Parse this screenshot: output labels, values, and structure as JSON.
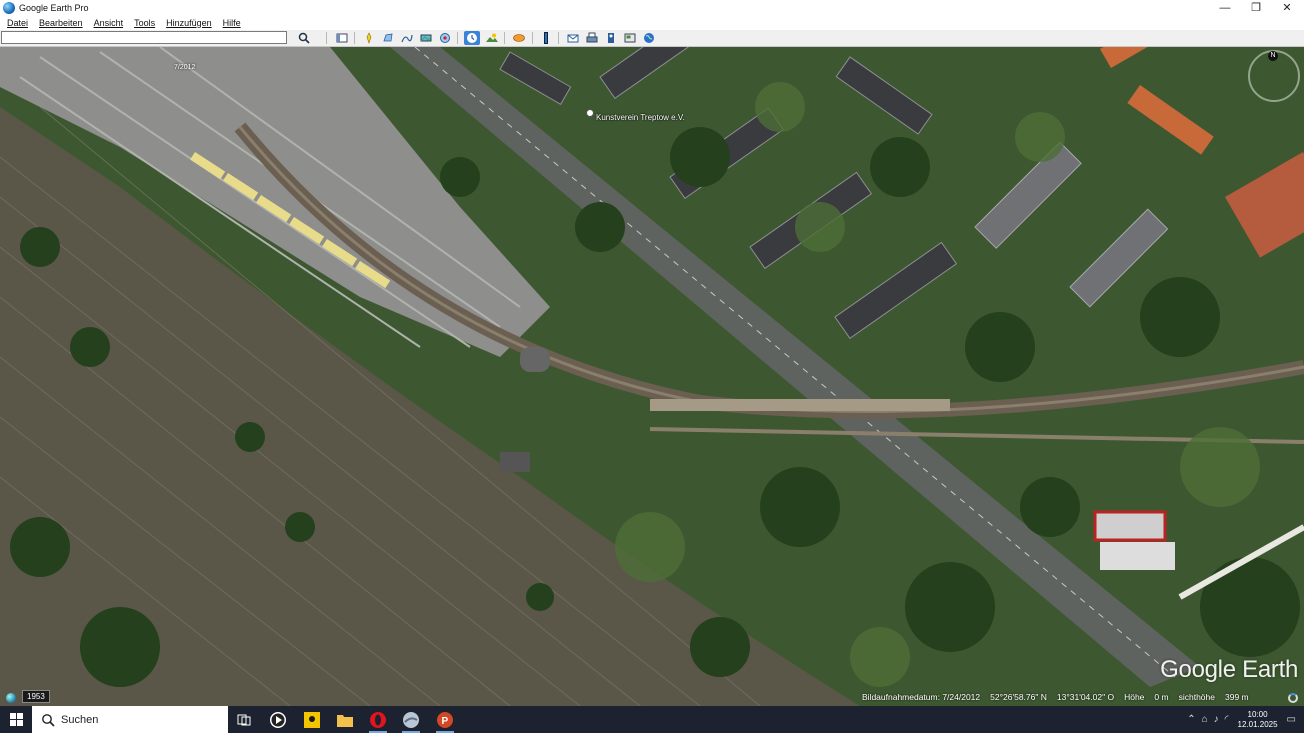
{
  "window": {
    "title": "Google Earth Pro",
    "controls": [
      "minimize-icon",
      "maximize-icon",
      "close-icon"
    ]
  },
  "menu": {
    "items": [
      {
        "label": "Datei"
      },
      {
        "label": "Bearbeiten"
      },
      {
        "label": "Ansicht"
      },
      {
        "label": "Tools"
      },
      {
        "label": "Hinzufügen"
      },
      {
        "label": "Hilfe"
      }
    ]
  },
  "toolbar": {
    "search_value": "",
    "buttons": [
      {
        "icon": "search-icon"
      },
      {
        "icon": "sidebar-toggle-icon"
      },
      {
        "icon": "add-placemark-icon"
      },
      {
        "icon": "add-polygon-icon"
      },
      {
        "icon": "add-path-icon"
      },
      {
        "icon": "add-overlay-icon"
      },
      {
        "icon": "record-tour-icon"
      },
      {
        "icon": "historical-imagery-icon",
        "active": true
      },
      {
        "icon": "sunlight-icon"
      },
      {
        "icon": "switch-planet-icon"
      },
      {
        "icon": "ruler-icon"
      },
      {
        "icon": "email-icon"
      },
      {
        "icon": "print-icon"
      },
      {
        "icon": "save-image-icon"
      },
      {
        "icon": "view-in-maps-icon"
      },
      {
        "icon": "earth-icon"
      }
    ]
  },
  "map": {
    "history_date": "7/2012",
    "place_label": "Kunstverein Treptow e.V.",
    "year_badge": "1953",
    "logo": "Google Earth",
    "compass_letter": "N",
    "status": {
      "imagery_date_label": "Bildaufnahmedatum: 7/24/2012",
      "lat": "52°26'58.76\" N",
      "lon": "13°31'04.02\" O",
      "elevation_label": "Höhe",
      "elevation_value": "0 m",
      "eye_alt_label": "sichthöhe",
      "eye_alt_value": "399 m"
    }
  },
  "taskbar": {
    "search_label": "Suchen",
    "apps": [
      {
        "icon": "task-view-icon"
      },
      {
        "icon": "media-player-icon"
      },
      {
        "icon": "maps-app-icon"
      },
      {
        "icon": "file-explorer-icon"
      },
      {
        "icon": "opera-browser-icon",
        "running": true
      },
      {
        "icon": "google-earth-app-icon",
        "running": true
      },
      {
        "icon": "powerpoint-icon",
        "running": true
      }
    ],
    "tray": {
      "time": "10:00",
      "date": "12.01.2025"
    }
  }
}
